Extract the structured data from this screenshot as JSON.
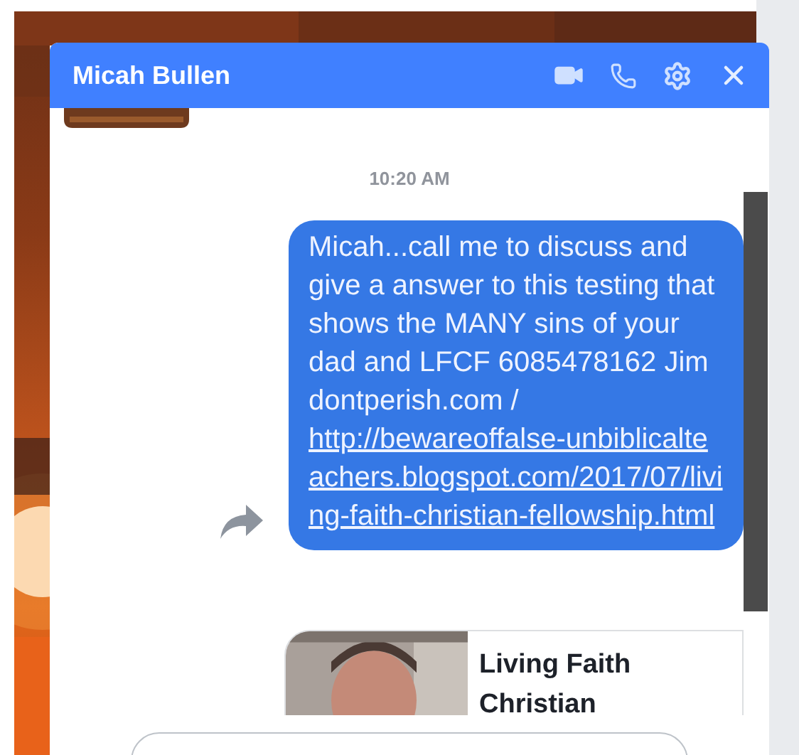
{
  "chat": {
    "title": "Micah Bullen",
    "timestamp": "10:20 AM",
    "message": {
      "text": "Micah...call me to discuss and give a answer to this testing that shows the MANY sins of your dad and LFCF 6085478162 Jim dontperish.com /",
      "link": "http://bewareoffalse-unbiblicalteachers.blogspot.com/2017/07/living-faith-christian-fellowship.html"
    },
    "preview": {
      "title": "Living Faith Christian"
    }
  }
}
